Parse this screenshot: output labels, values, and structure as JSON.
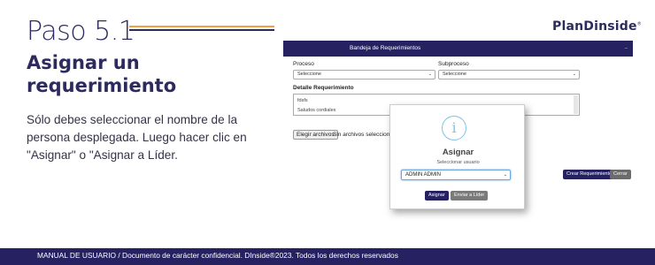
{
  "slide": {
    "step": "Paso 5.1",
    "logo": "PlanDinside",
    "logo_mark": "®",
    "heading": "Asignar un requerimiento",
    "description": "Sólo debes seleccionar el nombre de la persona desplegada. Luego hacer clic en \"Asignar\" o \"Asignar a Líder.",
    "footer": "MANUAL DE USUARIO / Documento de carácter confidencial. DInside®2023. Todos los derechos reservados"
  },
  "app": {
    "header_title": "Bandeja de Requerimientos",
    "proceso_label": "Proceso",
    "proceso_value": "Seleccione",
    "subproceso_label": "Subproceso",
    "subproceso_value": "Seleccione",
    "detalle_label": "Detalle Requerimiento",
    "detalle_lines": [
      "fdsfs",
      "Saludos cordiales"
    ],
    "file_button": "Elegir archivos",
    "file_text": "Sin archivos seleccionad",
    "crear_button": "Crear Requerimiento",
    "cerrar_button": "Cerrar"
  },
  "modal": {
    "icon": "info-icon",
    "title": "Asignar",
    "subtitle": "Seleccionar usuario",
    "select_value": "ADMIN ADMIN",
    "assign_button": "Asignar",
    "leader_button": "Enviar a Líder"
  },
  "colors": {
    "brand": "#262160",
    "accent": "#f0a040",
    "info": "#7ec3e6"
  }
}
